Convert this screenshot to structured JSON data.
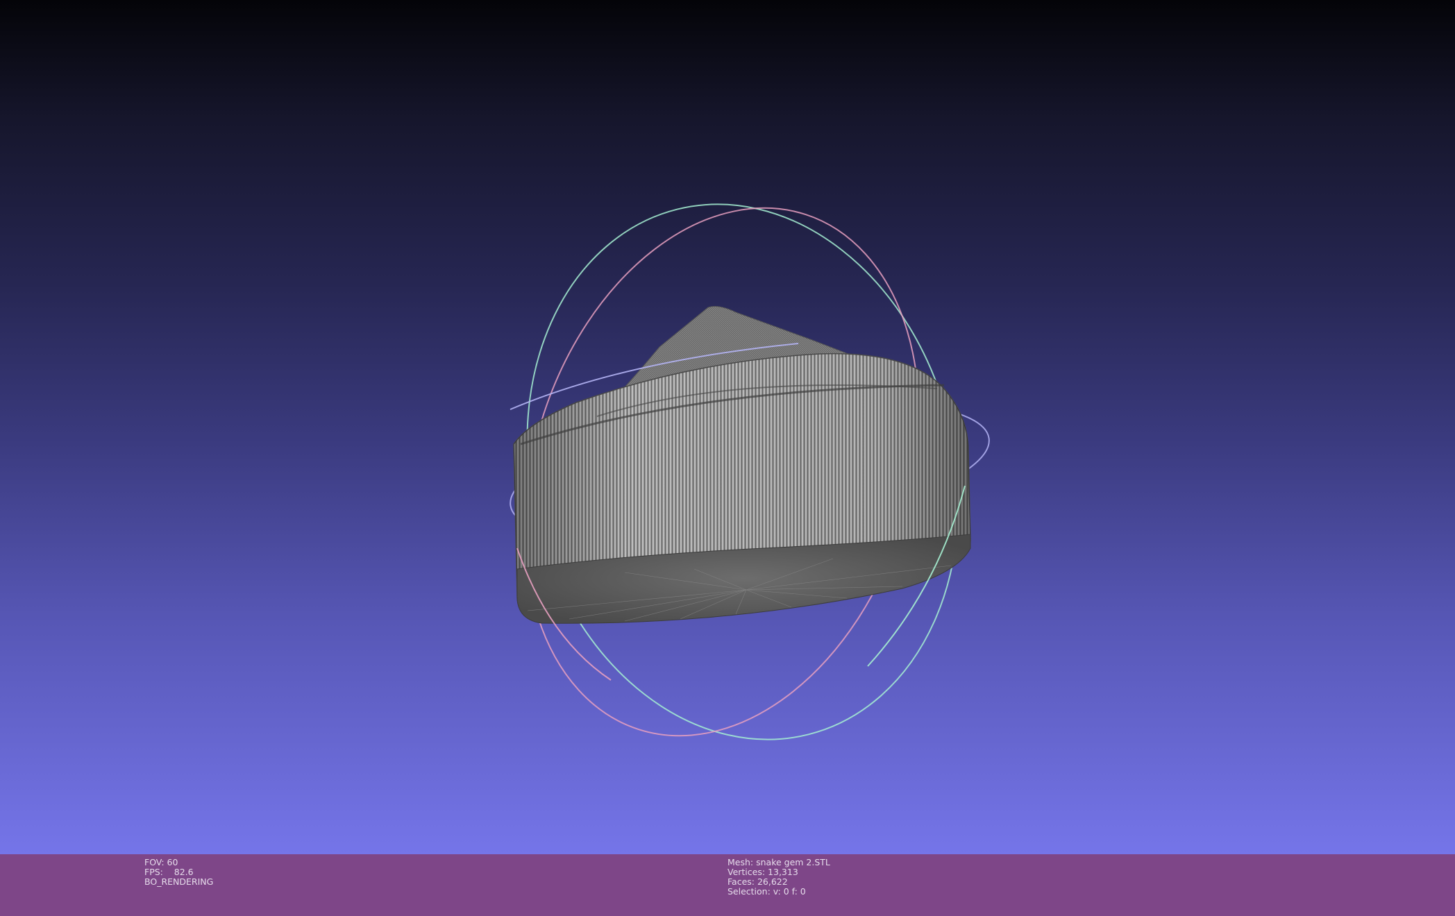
{
  "viewer": {
    "background_top": "#040408",
    "background_bottom": "#7575e9",
    "statusbar_color": "#7e4688",
    "mesh_color": "#b9b9b9",
    "trackball_colors": {
      "x_ring": "#e7a0c0",
      "y_ring": "#a6f0d2",
      "z_ring": "#b4b4f4"
    }
  },
  "render_info": {
    "fov": "FOV: 60",
    "fps": "FPS:    82.6",
    "mode": "BO_RENDERING"
  },
  "mesh_info": {
    "mesh": "Mesh: snake gem 2.STL",
    "vertices": "Vertices: 13,313",
    "faces": "Faces: 26,622",
    "selection": "Selection: v: 0 f: 0"
  }
}
